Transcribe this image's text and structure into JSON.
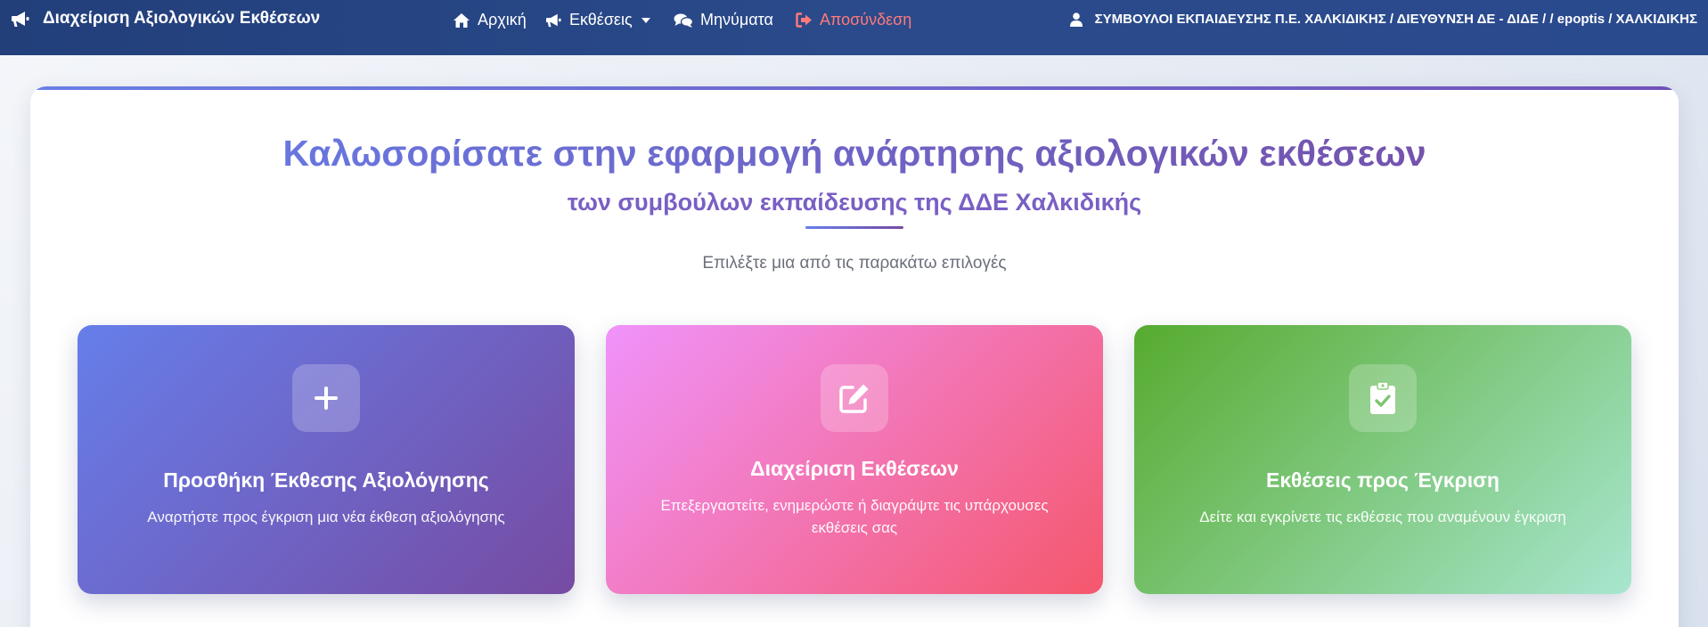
{
  "navbar": {
    "brand": "Διαχείριση Αξιολογικών Εκθέσεων",
    "brand_icon": "bullhorn-icon",
    "items": [
      {
        "label": "Αρχική",
        "icon": "home-icon"
      },
      {
        "label": "Εκθέσεις",
        "icon": "bullhorn-icon"
      },
      {
        "label": "Μηνύματα",
        "icon": "comments-icon"
      },
      {
        "label": "Αποσύνδεση",
        "icon": "sign-out-icon"
      }
    ],
    "user": "ΣΥΜΒΟΥΛΟΙ ΕΚΠΑΙΔΕΥΣΗΣ Π.Ε. ΧΑΛΚΙΔΙΚΗΣ / ΔΙΕΥΘΥΝΣΗ ΔΕ - ΔΙΔΕ / / epoptis / ΧΑΛΚΙΔΙΚΗΣ",
    "user_icon": "user-icon",
    "logout_color": "#ff7a7a"
  },
  "main": {
    "title": "Καλωσορίσατε στην εφαρμογή ανάρτησης αξιολογικών εκθέσεων",
    "subtitle": "των συμβούλων εκπαίδευσης της ΔΔΕ Χαλκιδικής",
    "lead": "Επιλέξτε μια από τις παρακάτω επιλογές"
  },
  "cards": [
    {
      "title": "Προσθήκη Έκθεσης Αξιολόγησης",
      "description": "Αναρτήστε προς έγκριση μια νέα έκθεση αξιολόγησης",
      "icon": "plus-icon",
      "gradient": [
        "#667eea",
        "#764ba2"
      ]
    },
    {
      "title": "Διαχείριση Εκθέσεων",
      "description": "Επεξεργαστείτε, ενημερώστε ή διαγράψτε τις υπάρχουσες εκθέσεις σας",
      "icon": "edit-icon",
      "gradient": [
        "#f093fb",
        "#f5576c"
      ]
    },
    {
      "title": "Εκθέσεις προς Έγκριση",
      "description": "Δείτε και εγκρίνετε τις εκθέσεις που αναμένουν έγκριση",
      "icon": "clipboard-check-icon",
      "gradient": [
        "#56ab2f",
        "#a8e6cf"
      ]
    }
  ]
}
